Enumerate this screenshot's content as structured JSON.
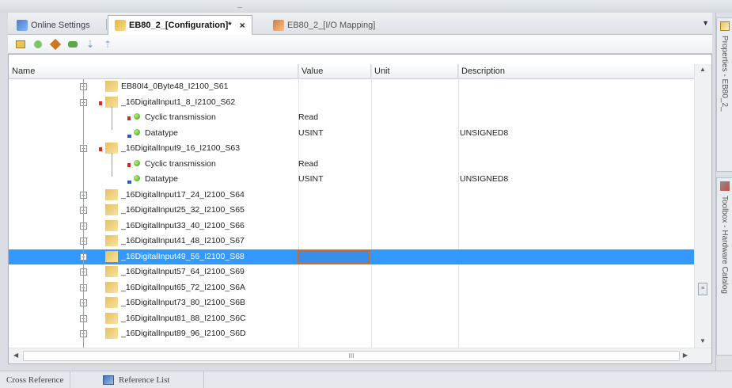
{
  "tabs": [
    {
      "label": "Online Settings",
      "icon": "online-settings-icon",
      "active": false
    },
    {
      "label": "EB80_2_[Configuration]*",
      "icon": "configuration-icon",
      "active": true
    },
    {
      "label": "EB80_2_[I/O Mapping]",
      "icon": "io-mapping-icon",
      "active": false
    }
  ],
  "close_symbol": "×",
  "dropdown_symbol": "▼",
  "columns": {
    "name": "Name",
    "value": "Value",
    "unit": "Unit",
    "description": "Description"
  },
  "rows": [
    {
      "name": "EB80I4_0Byte48_I2100_S61",
      "value": "",
      "description": ""
    },
    {
      "name": "_16DigitalInput1_8_I2100_S62",
      "value": "",
      "description": ""
    },
    {
      "name": "Cyclic transmission",
      "value": "Read",
      "description": ""
    },
    {
      "name": "Datatype",
      "value": "USINT",
      "description": "UNSIGNED8"
    },
    {
      "name": "_16DigitalInput9_16_I2100_S63",
      "value": "",
      "description": ""
    },
    {
      "name": "Cyclic transmission",
      "value": "Read",
      "description": ""
    },
    {
      "name": "Datatype",
      "value": "USINT",
      "description": "UNSIGNED8"
    },
    {
      "name": "_16DigitalInput17_24_I2100_S64",
      "value": "",
      "description": ""
    },
    {
      "name": "_16DigitalInput25_32_I2100_S65",
      "value": "",
      "description": ""
    },
    {
      "name": "_16DigitalInput33_40_I2100_S66",
      "value": "",
      "description": ""
    },
    {
      "name": "_16DigitalInput41_48_I2100_S67",
      "value": "",
      "description": ""
    },
    {
      "name": "_16DigitalInput49_56_I2100_S68",
      "value": "",
      "description": ""
    },
    {
      "name": "_16DigitalInput57_64_I2100_S69",
      "value": "",
      "description": ""
    },
    {
      "name": "_16DigitalInput65_72_I2100_S6A",
      "value": "",
      "description": ""
    },
    {
      "name": "_16DigitalInput73_80_I2100_S6B",
      "value": "",
      "description": ""
    },
    {
      "name": "_16DigitalInput81_88_I2100_S6C",
      "value": "",
      "description": ""
    },
    {
      "name": "_16DigitalInput89_96_I2100_S6D",
      "value": "",
      "description": ""
    }
  ],
  "hscroll_thumb_label": "III",
  "bottom_tabs": [
    {
      "label": "Cross Reference"
    },
    {
      "label": "Reference List"
    }
  ],
  "side_tabs": [
    {
      "label": "Properties - EB80_2_"
    },
    {
      "label": "Toolbox - Hardware Catalog"
    }
  ]
}
